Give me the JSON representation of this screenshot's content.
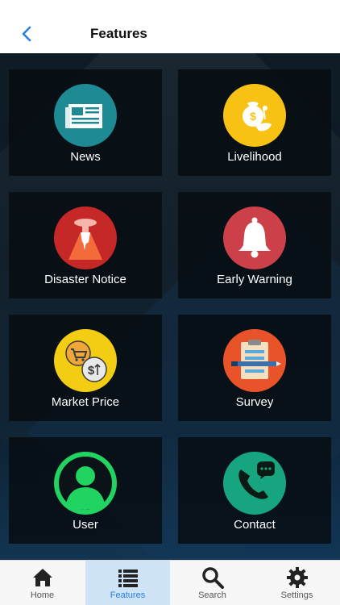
{
  "header": {
    "title": "Features",
    "back_icon": "chevron-left-icon"
  },
  "features": [
    {
      "label": "News",
      "icon": "newspaper-icon",
      "color": "#1d8a94"
    },
    {
      "label": "Livelihood",
      "icon": "money-bag-icon",
      "color": "#f7c214"
    },
    {
      "label": "Disaster Notice",
      "icon": "volcano-icon",
      "color": "#c62828"
    },
    {
      "label": "Early Warning",
      "icon": "bell-icon",
      "color": "#cc4149"
    },
    {
      "label": "Market Price",
      "icon": "cart-exchange-icon",
      "color": "#f2cd14"
    },
    {
      "label": "Survey",
      "icon": "clipboard-pen-icon",
      "color": "#e8532a"
    },
    {
      "label": "User",
      "icon": "user-icon",
      "color": "#21d361"
    },
    {
      "label": "Contact",
      "icon": "phone-chat-icon",
      "color": "#16a57e"
    }
  ],
  "tabs": [
    {
      "label": "Home",
      "icon": "home-icon",
      "active": false
    },
    {
      "label": "Features",
      "icon": "list-icon",
      "active": true
    },
    {
      "label": "Search",
      "icon": "search-icon",
      "active": false
    },
    {
      "label": "Settings",
      "icon": "gear-icon",
      "active": false
    }
  ],
  "colors": {
    "accent": "#2a7de1",
    "active_tab_bg": "#cfe3f7",
    "tile_bg": "#070d12"
  }
}
